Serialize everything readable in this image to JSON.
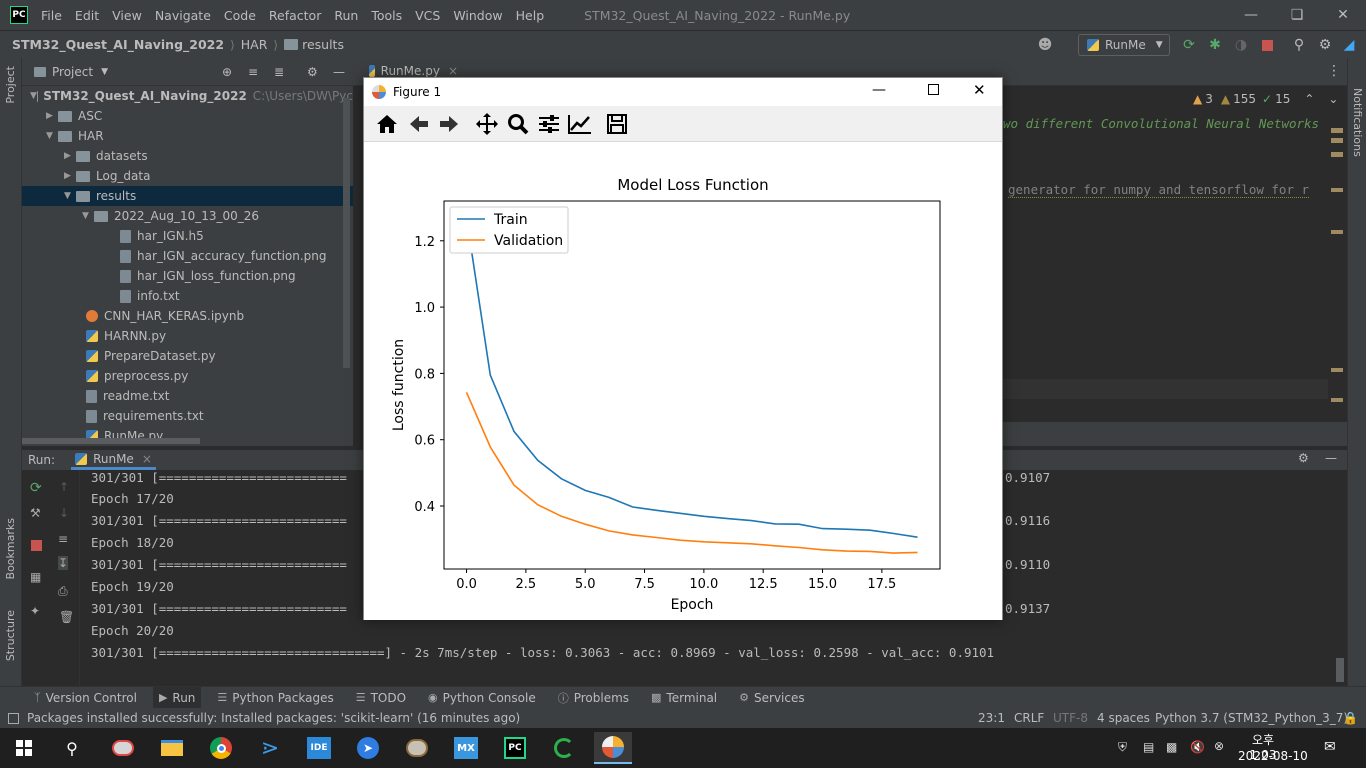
{
  "titlebar": {
    "logo": "PC",
    "menu": [
      "File",
      "Edit",
      "View",
      "Navigate",
      "Code",
      "Refactor",
      "Run",
      "Tools",
      "VCS",
      "Window",
      "Help"
    ],
    "title": "STM32_Quest_AI_Naving_2022 - RunMe.py",
    "controls": [
      "minimize-icon",
      "restore-icon",
      "close-icon"
    ]
  },
  "navbar": {
    "breadcrumbs": [
      "STM32_Quest_AI_Naving_2022",
      "HAR",
      "results"
    ],
    "run_config": "RunMe"
  },
  "project": {
    "label": "Project",
    "root": "STM32_Quest_AI_Naving_2022",
    "root_path": "C:\\Users\\DW\\Pyc",
    "items": [
      "ASC",
      "HAR",
      "datasets",
      "Log_data",
      "results",
      "2022_Aug_10_13_00_26",
      "har_IGN.h5",
      "har_IGN_accuracy_function.png",
      "har_IGN_loss_function.png",
      "info.txt",
      "CNN_HAR_KERAS.ipynb",
      "HARNN.py",
      "PrepareDataset.py",
      "preprocess.py",
      "readme.txt",
      "requirements.txt",
      "RunMe.py"
    ]
  },
  "editor": {
    "tab": "RunMe.py",
    "inspections": {
      "warnings": "3",
      "weak": "155",
      "typos": "15"
    },
    "line1": "wo different Convolutional Neural Networks",
    "line2": "generator for numpy and tensorflow for r"
  },
  "run": {
    "label": "Run:",
    "tab": "RunMe",
    "lines": [
      {
        "left": "301/301 [=========================",
        "right": "0.9107"
      },
      {
        "left": "Epoch 17/20",
        "right": ""
      },
      {
        "left": "301/301 [=========================",
        "right": "0.9116"
      },
      {
        "left": "Epoch 18/20",
        "right": ""
      },
      {
        "left": "301/301 [=========================",
        "right": "0.9110"
      },
      {
        "left": "Epoch 19/20",
        "right": ""
      },
      {
        "left": "301/301 [=========================",
        "right": "0.9137"
      },
      {
        "left": "Epoch 20/20",
        "right": ""
      },
      {
        "left": "301/301 [==============================] - 2s 7ms/step - loss: 0.3063 - acc: 0.8969 - val_loss: 0.2598 - val_acc: 0.9101",
        "right": ""
      }
    ]
  },
  "sidebars": {
    "project": "Project",
    "bookmarks": "Bookmarks",
    "structure": "Structure",
    "notifications": "Notifications"
  },
  "bottom_tabs": [
    "Version Control",
    "Run",
    "Python Packages",
    "TODO",
    "Python Console",
    "Problems",
    "Terminal",
    "Services"
  ],
  "status": {
    "message": "Packages installed successfully: Installed packages: 'scikit-learn' (16 minutes ago)",
    "position": "23:1",
    "line_sep": "CRLF",
    "encoding": "UTF-8",
    "indent": "4 spaces",
    "interpreter": "Python 3.7 (STM32_Python_3_7)"
  },
  "taskbar": {
    "time": "오후 1:03",
    "date": "2022-08-10",
    "apps": [
      "windows-start-icon",
      "search-icon",
      "paint-icon",
      "file-explorer-icon",
      "chrome-icon",
      "vscode-icon",
      "ide-icon",
      "stm-cube-icon",
      "paint3d-icon",
      "mx-icon",
      "pycharm-icon",
      "refresh-app-icon",
      "matplotlib-icon"
    ]
  },
  "figure": {
    "title": "Figure 1"
  },
  "chart_data": {
    "type": "line",
    "title": "Model Loss Function",
    "xlabel": "Epoch",
    "ylabel": "Loss function",
    "xlim": [
      -0.95,
      19.95
    ],
    "ylim": [
      0.21,
      1.32
    ],
    "xticks": [
      "0.0",
      "2.5",
      "5.0",
      "7.5",
      "10.0",
      "12.5",
      "15.0",
      "17.5"
    ],
    "yticks": [
      "0.4",
      "0.6",
      "0.8",
      "1.0",
      "1.2"
    ],
    "legend_position": "upper-left",
    "x": [
      0,
      1,
      2,
      3,
      4,
      5,
      6,
      7,
      8,
      9,
      10,
      11,
      12,
      13,
      14,
      15,
      16,
      17,
      18,
      19
    ],
    "series": [
      {
        "name": "Train",
        "color": "#1f77b4",
        "values": [
          1.27,
          0.795,
          0.625,
          0.538,
          0.482,
          0.447,
          0.426,
          0.397,
          0.387,
          0.378,
          0.369,
          0.362,
          0.356,
          0.346,
          0.345,
          0.332,
          0.33,
          0.327,
          0.317,
          0.306
        ]
      },
      {
        "name": "Validation",
        "color": "#ff7f0e",
        "values": [
          0.743,
          0.578,
          0.463,
          0.404,
          0.369,
          0.345,
          0.325,
          0.313,
          0.305,
          0.297,
          0.292,
          0.289,
          0.286,
          0.28,
          0.275,
          0.268,
          0.264,
          0.263,
          0.258,
          0.26
        ]
      }
    ]
  }
}
